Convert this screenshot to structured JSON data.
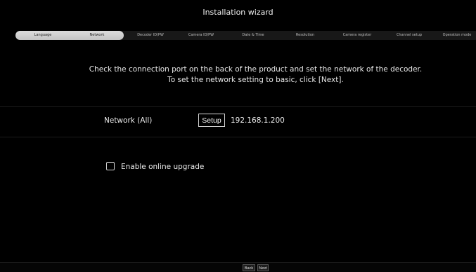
{
  "window": {
    "title": "Installation wizard"
  },
  "steps": {
    "current_index": 1,
    "items": [
      {
        "label": "Language"
      },
      {
        "label": "Network"
      },
      {
        "label": "Decoder ID/PW"
      },
      {
        "label": "Camera ID/PW"
      },
      {
        "label": "Date & Time"
      },
      {
        "label": "Resolution"
      },
      {
        "label": "Camera register"
      },
      {
        "label": "Channel setup"
      },
      {
        "label": "Operation mode"
      }
    ]
  },
  "instruction": {
    "line1": "Check the connection port on the back of the product and set the network of the decoder.",
    "line2": "To set the network setting to basic, click [Next]."
  },
  "network": {
    "label": "Network (All)",
    "setup_label": "Setup",
    "ip_address": "192.168.1.200"
  },
  "online_upgrade": {
    "label": "Enable online upgrade",
    "checked": false
  },
  "footer": {
    "back_label": "Back",
    "next_label": "Next"
  }
}
